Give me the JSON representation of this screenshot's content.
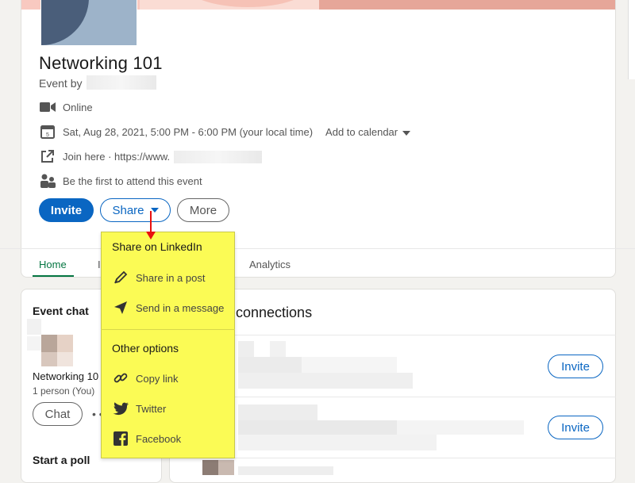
{
  "event": {
    "title": "Networking 101",
    "by_prefix": "Event by",
    "format": "Online",
    "datetime": "Sat, Aug 28, 2021, 5:00 PM - 6:00 PM (your local time)",
    "add_to_calendar": "Add to calendar",
    "join_link": "Join here · https://www.",
    "attendees": "Be the first to attend this event"
  },
  "actions": {
    "invite": "Invite",
    "share": "Share",
    "more": "More"
  },
  "tabs": {
    "home": "Home",
    "analytics": "Analytics"
  },
  "share_menu": {
    "linkedin_header": "Share on LinkedIn",
    "share_post": "Share in a post",
    "send_message": "Send in a message",
    "other_header": "Other options",
    "copy_link": "Copy link",
    "twitter": "Twitter",
    "facebook": "Facebook"
  },
  "chat": {
    "header": "Event chat",
    "group_name": "Networking 10",
    "members": "1 person (You)",
    "chat_button": "Chat",
    "poll_header": "Start a poll"
  },
  "connections": {
    "title": "connections",
    "invite_label": "Invite"
  },
  "colors": {
    "primary_blue": "#0a66c2",
    "active_green": "#057642",
    "highlight_yellow": "#fbfb55",
    "annotation_red": "#e81010"
  }
}
